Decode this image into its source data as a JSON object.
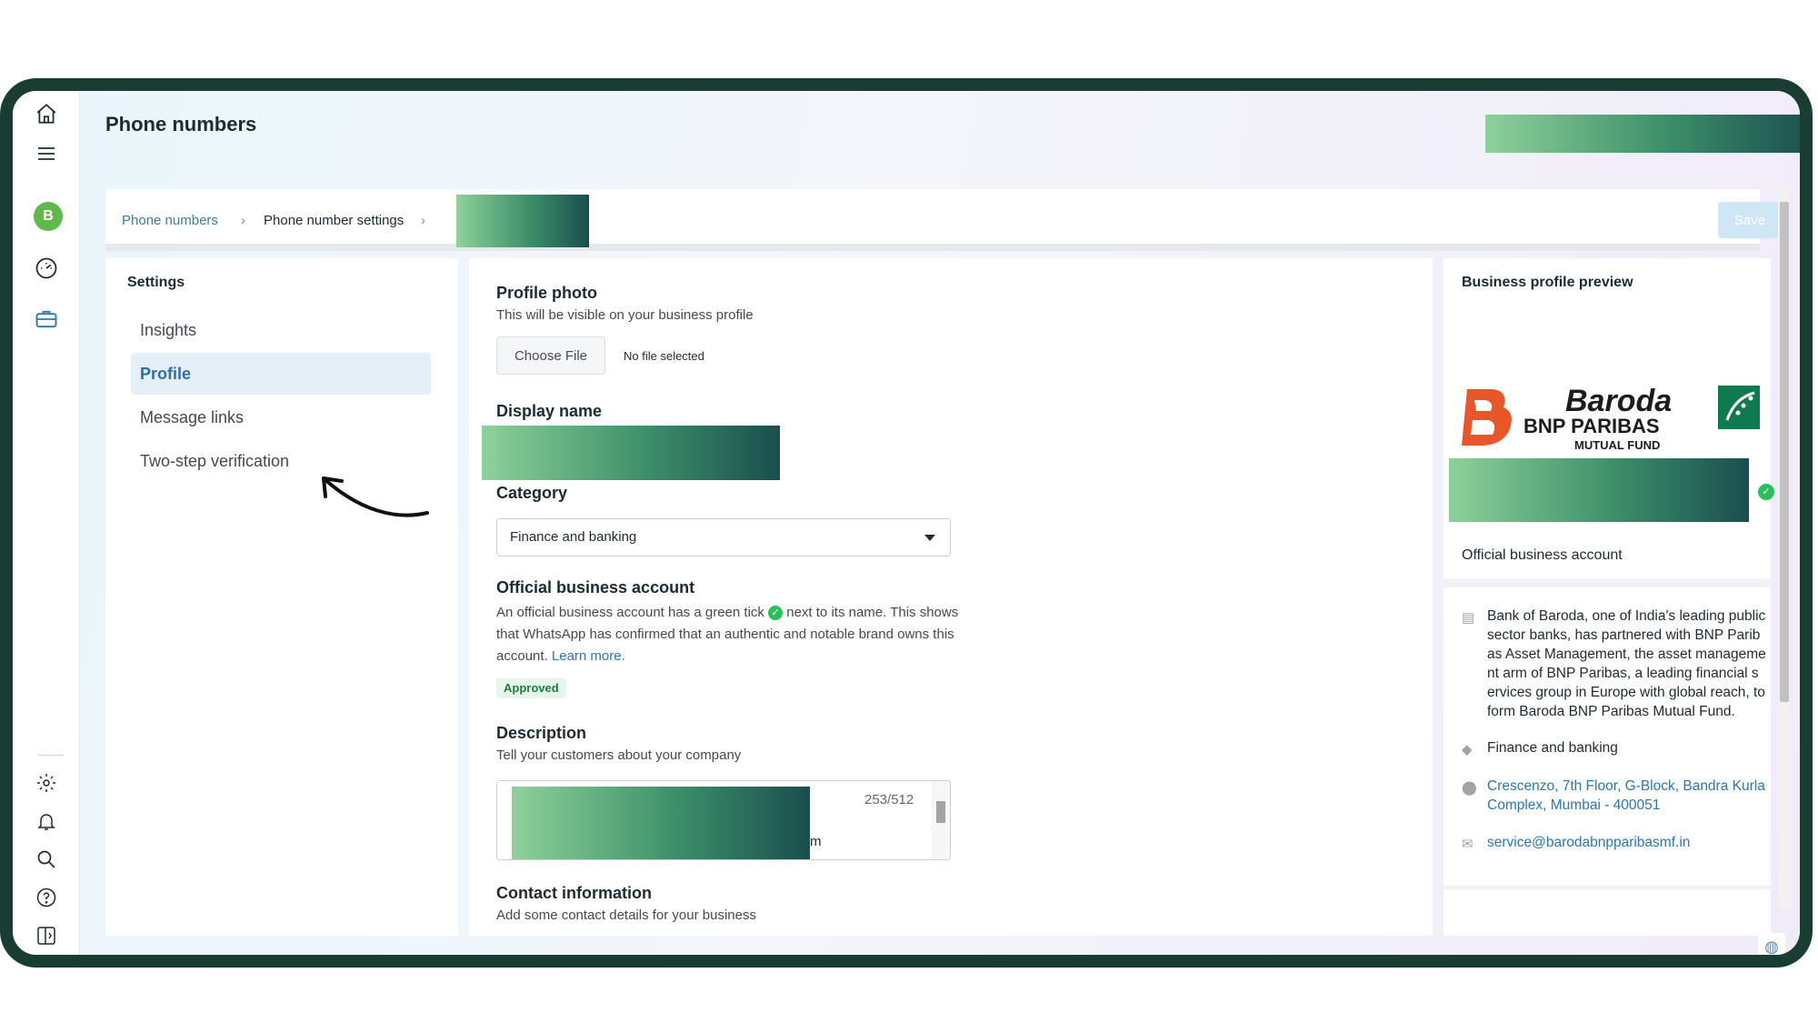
{
  "header": {
    "title": "Phone numbers"
  },
  "breadcrumb": {
    "items": [
      "Phone numbers",
      "Phone number settings"
    ],
    "separator": "›"
  },
  "toolbar": {
    "save_label": "Save"
  },
  "settings": {
    "heading": "Settings",
    "items": [
      {
        "label": "Insights",
        "active": false
      },
      {
        "label": "Profile",
        "active": true
      },
      {
        "label": "Message links",
        "active": false
      },
      {
        "label": "Two-step verification",
        "active": false
      }
    ]
  },
  "profile": {
    "photo_title": "Profile photo",
    "photo_subtitle": "This will be visible on your business profile",
    "choose_file_label": "Choose File",
    "no_file_label": "No file selected",
    "display_name_title": "Display name",
    "category_title": "Category",
    "category_value": "Finance and banking",
    "oba_title": "Official business account",
    "oba_text_1": "An official business account has a green tick",
    "oba_text_2": "next to its name. This shows that WhatsApp has confirmed that an authentic and notable brand owns this account.",
    "oba_link": "Learn more.",
    "oba_status": "Approved",
    "description_title": "Description",
    "description_subtitle": "Tell your customers about your company",
    "description_tail": "m",
    "description_count": "253/512",
    "contact_title": "Contact information",
    "contact_subtitle": "Add some contact details for your business"
  },
  "preview": {
    "heading": "Business profile preview",
    "logo": {
      "line1": "Baroda",
      "line2": "BNP PARIBAS",
      "line3": "MUTUAL FUND"
    },
    "oba_label": "Official business account",
    "about": "Bank of Baroda, one of India's leading public sector banks, has partnered with BNP Paribas Asset Management, the asset management arm of BNP Paribas, a leading financial services group in Europe with global reach, to form Baroda BNP Paribas Mutual Fund.",
    "category": "Finance and banking",
    "address": "Crescenzo, 7th Floor, G-Block, Bandra Kurla Complex, Mumbai - 400051",
    "email": "service@barodabnpparibasmf.in"
  },
  "rail": {
    "avatar_letter": "B"
  },
  "colors": {
    "frame": "#1a3d33",
    "accent": "#2c6fa3",
    "approved": "#1e7e3e",
    "verified_tick": "#25c25a"
  },
  "icons": [
    "home-icon",
    "menu-icon",
    "avatar",
    "speedometer-icon",
    "briefcase-icon",
    "gear-icon",
    "bell-icon",
    "search-icon",
    "help-icon",
    "panel-toggle-icon",
    "globe-icon"
  ]
}
